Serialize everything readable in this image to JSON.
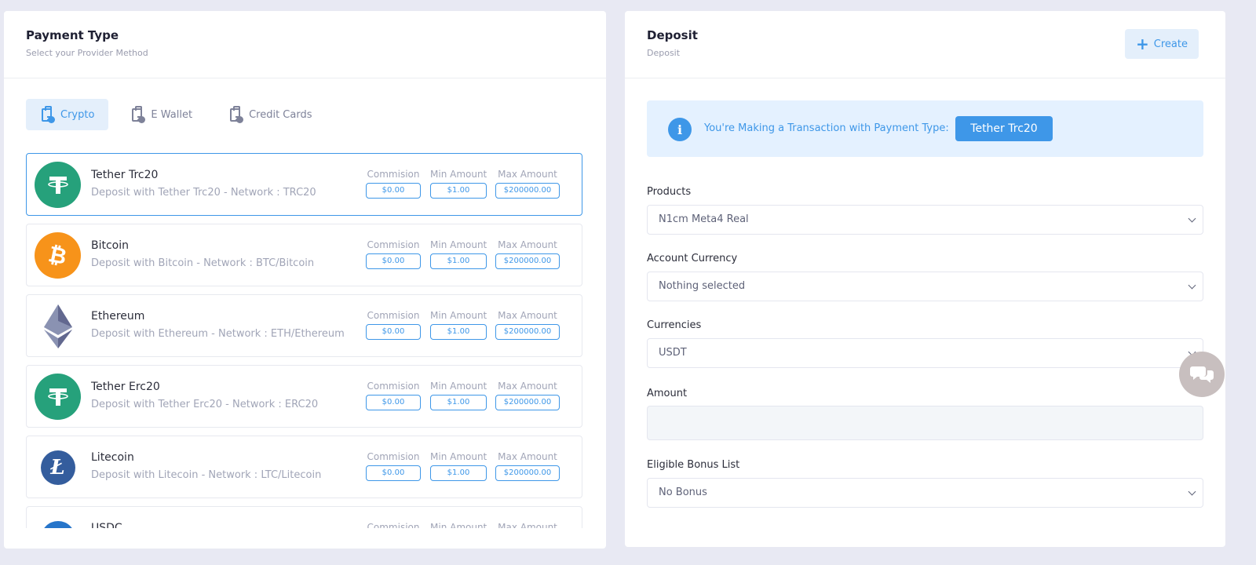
{
  "payment_type": {
    "title": "Payment Type",
    "subtitle": "Select your Provider Method",
    "tabs": [
      {
        "label": "Crypto",
        "active": true
      },
      {
        "label": "E Wallet",
        "active": false
      },
      {
        "label": "Credit Cards",
        "active": false
      }
    ],
    "fee_labels": {
      "commission": "Commision",
      "min": "Min Amount",
      "max": "Max Amount"
    },
    "methods": [
      {
        "name": "Tether Trc20",
        "desc": "Deposit with Tether Trc20 - Network : TRC20",
        "commission": "$0.00",
        "min": "$1.00",
        "max": "$200000.00",
        "icon": "tether-icon",
        "color": "#26a17b",
        "selected": true
      },
      {
        "name": "Bitcoin",
        "desc": "Deposit with Bitcoin - Network : BTC/Bitcoin",
        "commission": "$0.00",
        "min": "$1.00",
        "max": "$200000.00",
        "icon": "bitcoin-icon",
        "color": "#f7931a",
        "selected": false
      },
      {
        "name": "Ethereum",
        "desc": "Deposit with Ethereum - Network : ETH/Ethereum",
        "commission": "$0.00",
        "min": "$1.00",
        "max": "$200000.00",
        "icon": "ethereum-icon",
        "color": "#627eea",
        "selected": false
      },
      {
        "name": "Tether Erc20",
        "desc": "Deposit with Tether Erc20 - Network : ERC20",
        "commission": "$0.00",
        "min": "$1.00",
        "max": "$200000.00",
        "icon": "tether-icon",
        "color": "#26a17b",
        "selected": false
      },
      {
        "name": "Litecoin",
        "desc": "Deposit with Litecoin - Network : LTC/Litecoin",
        "commission": "$0.00",
        "min": "$1.00",
        "max": "$200000.00",
        "icon": "litecoin-icon",
        "color": "#345d9d",
        "selected": false
      },
      {
        "name": "USDC",
        "desc": "",
        "commission": "",
        "min": "",
        "max": "",
        "icon": "usdc-icon",
        "color": "#2775ca",
        "selected": false
      }
    ]
  },
  "deposit": {
    "title": "Deposit",
    "subtitle": "Deposit",
    "create_label": "Create",
    "notice_text": "You're Making a Transaction with Payment Type:",
    "notice_badge": "Tether Trc20",
    "fields": {
      "products_label": "Products",
      "products_value": "N1cm Meta4 Real",
      "account_currency_label": "Account Currency",
      "account_currency_value": "Nothing selected",
      "currencies_label": "Currencies",
      "currencies_value": "USDT",
      "amount_label": "Amount",
      "amount_value": "",
      "bonus_label": "Eligible Bonus List",
      "bonus_value": "No Bonus"
    }
  },
  "colors": {
    "accent": "#3e97e8",
    "accent_light": "#e4effb"
  },
  "chat": {
    "icon": "chat-bubbles-icon"
  }
}
